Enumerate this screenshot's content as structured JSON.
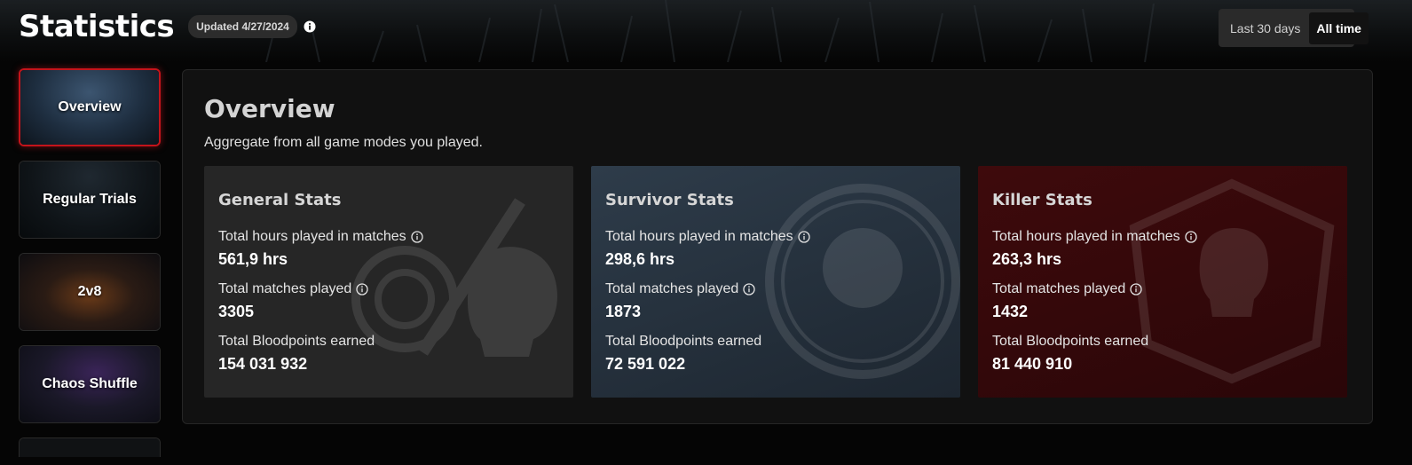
{
  "header": {
    "title": "Statistics",
    "updated_badge": "Updated 4/27/2024",
    "info_icon": "info-icon"
  },
  "range_toggle": {
    "options": [
      "Last 30 days",
      "All time"
    ],
    "selected": "All time"
  },
  "sidebar": {
    "items": [
      {
        "label": "Overview",
        "active": true
      },
      {
        "label": "Regular Trials",
        "active": false
      },
      {
        "label": "2v8",
        "active": false
      },
      {
        "label": "Chaos Shuffle",
        "active": false
      }
    ]
  },
  "overview": {
    "title": "Overview",
    "subtitle": "Aggregate from all game modes you played."
  },
  "cards": {
    "general": {
      "title": "General Stats",
      "hours_label": "Total hours played in matches",
      "hours_value": "561,9 hrs",
      "matches_label": "Total matches played",
      "matches_value": "3305",
      "bloodpoints_label": "Total Bloodpoints earned",
      "bloodpoints_value": "154 031 932"
    },
    "survivor": {
      "title": "Survivor Stats",
      "hours_label": "Total hours played in matches",
      "hours_value": "298,6 hrs",
      "matches_label": "Total matches played",
      "matches_value": "1873",
      "bloodpoints_label": "Total Bloodpoints earned",
      "bloodpoints_value": "72 591 022"
    },
    "killer": {
      "title": "Killer Stats",
      "hours_label": "Total hours played in matches",
      "hours_value": "263,3 hrs",
      "matches_label": "Total matches played",
      "matches_value": "1432",
      "bloodpoints_label": "Total Bloodpoints earned",
      "bloodpoints_value": "81 440 910"
    }
  },
  "colors": {
    "accent_red": "#c4141b",
    "survivor_card": "#2e3c4a",
    "killer_card": "#3e0a0c",
    "general_card": "#262626"
  }
}
